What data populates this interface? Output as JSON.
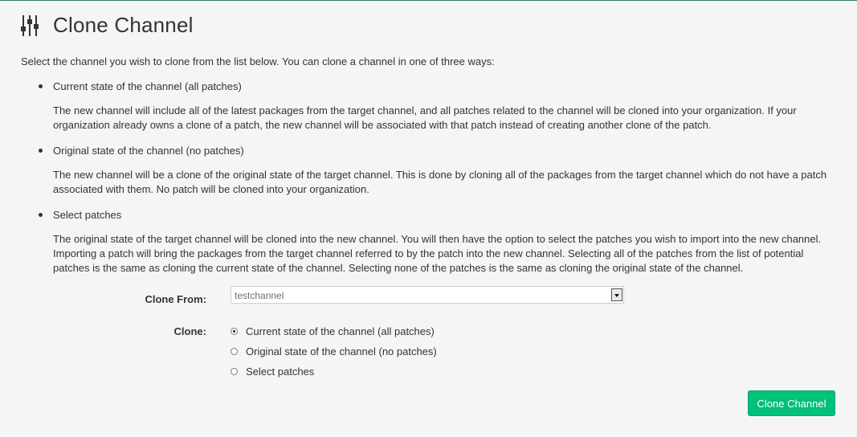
{
  "header": {
    "title": "Clone Channel",
    "icon": "sliders-icon"
  },
  "intro": "Select the channel you wish to clone from the list below. You can clone a channel in one of three ways:",
  "options": [
    {
      "title": "Current state of the channel (all patches)",
      "description_lines": [
        "The new channel will include all of the latest packages from the target channel, and all patches related to the channel will be cloned into your organization. If your",
        "organization already owns a clone of a patch, the new channel will be associated with that patch instead of creating another clone of the patch."
      ]
    },
    {
      "title": "Original state of the channel (no patches)",
      "description_lines": [
        "The new channel will be a clone of the original state of the target channel. This is done by cloning all of the packages from the target channel which do not have a patch",
        "associated with them. No patch will be cloned into your organization."
      ]
    },
    {
      "title": "Select patches",
      "description_lines": [
        "The original state of the target channel will be cloned into the new channel. You will then have the option to select the patches you wish to import into the new channel.",
        "Importing a patch will bring the packages from the target channel referred to by the patch into the new channel. Selecting all of the patches from the list of potential",
        "patches is the same as cloning the current state of the channel. Selecting none of the patches is the same as cloning the original state of the channel."
      ]
    }
  ],
  "form": {
    "clone_from_label": "Clone From:",
    "clone_from_value": "testchannel",
    "clone_label": "Clone:",
    "radios": [
      {
        "label": "Current state of the channel (all patches)",
        "checked": true
      },
      {
        "label": "Original state of the channel (no patches)",
        "checked": false
      },
      {
        "label": "Select patches",
        "checked": false
      }
    ],
    "submit_label": "Clone Channel"
  },
  "colors": {
    "accent": "#00c07a",
    "top_border": "#2f7d5b",
    "background": "#f5f5f5"
  }
}
